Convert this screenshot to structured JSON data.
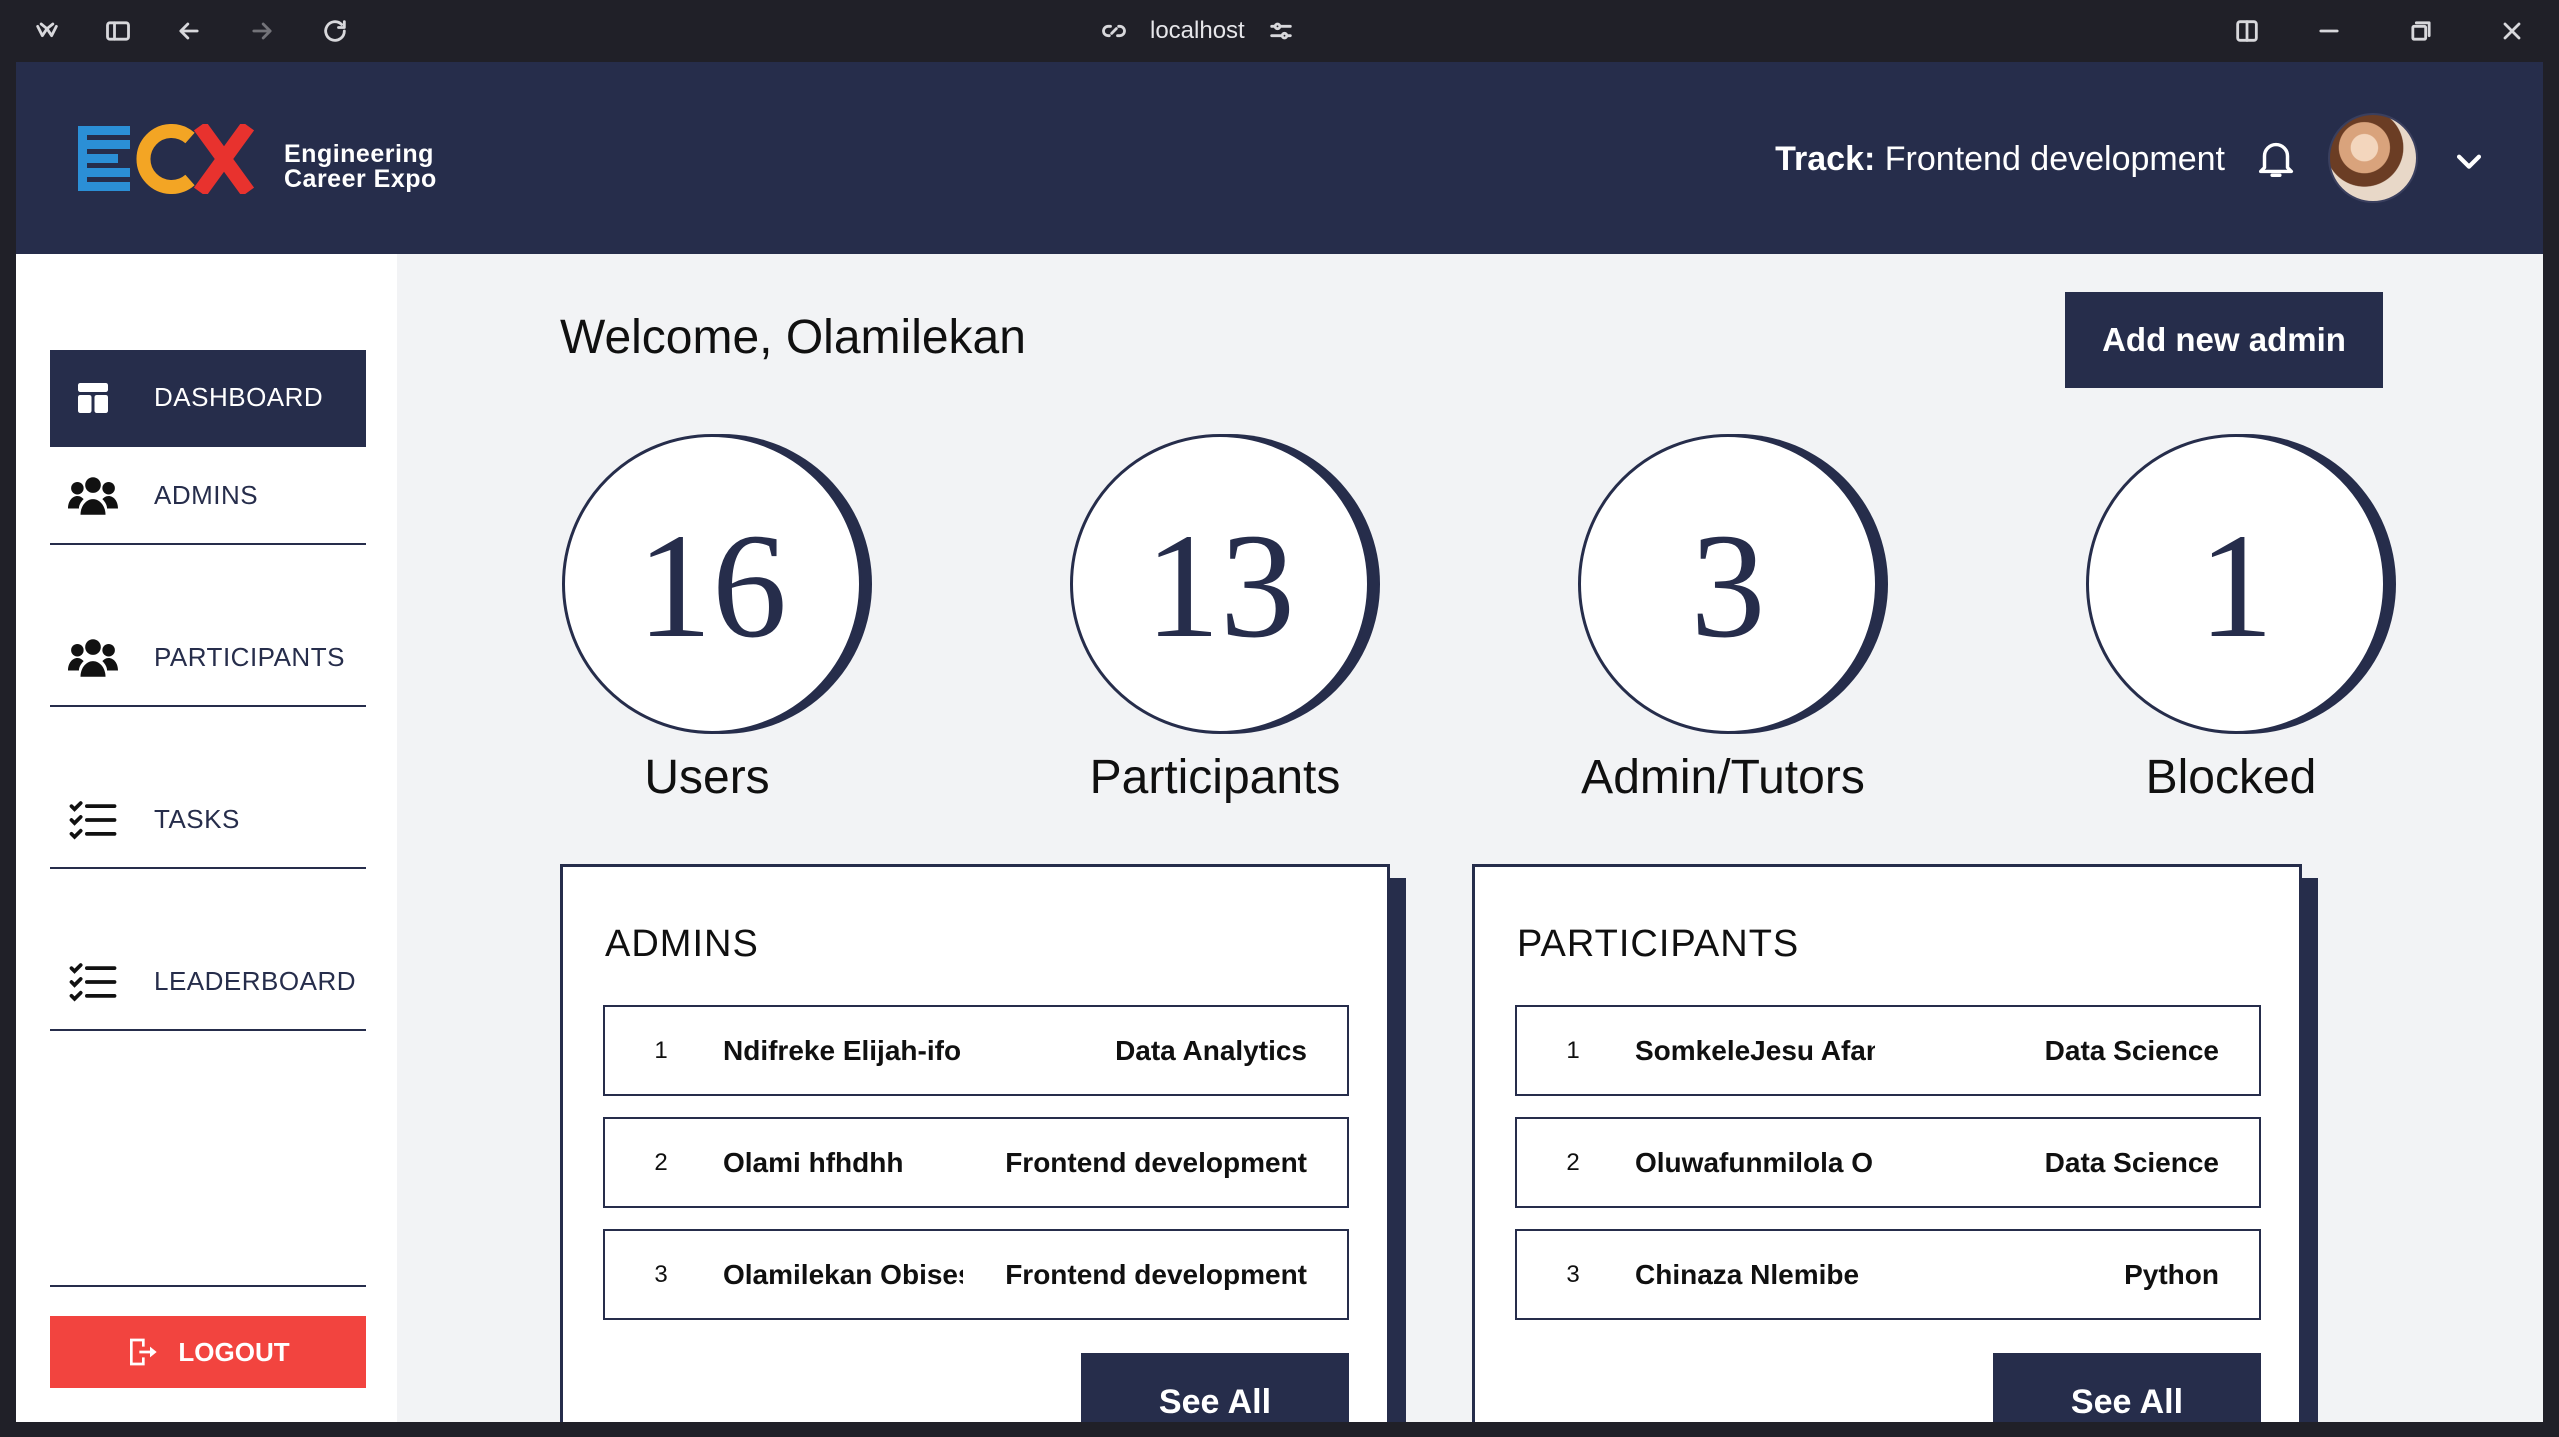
{
  "browser": {
    "address": "localhost"
  },
  "brand": {
    "line1": "Engineering",
    "line2": "Career Expo",
    "colors": {
      "blue": "#2b8fd6",
      "orange": "#f3a524",
      "red": "#e8322e"
    }
  },
  "header": {
    "track_label": "Track:",
    "track_value": "Frontend development"
  },
  "sidebar": {
    "items": [
      {
        "label": "DASHBOARD",
        "icon": "dashboard-icon",
        "active": true
      },
      {
        "label": "ADMINS",
        "icon": "users-group-icon",
        "active": false
      },
      {
        "label": "PARTICIPANTS",
        "icon": "users-group-icon",
        "active": false
      },
      {
        "label": "TASKS",
        "icon": "checklist-icon",
        "active": false
      },
      {
        "label": "LEADERBOARD",
        "icon": "checklist-icon",
        "active": false
      }
    ],
    "logout_label": "LOGOUT"
  },
  "main": {
    "welcome": "Welcome, Olamilekan",
    "add_admin_label": "Add new admin",
    "stats": [
      {
        "value": "16",
        "label": "Users"
      },
      {
        "value": "13",
        "label": "Participants"
      },
      {
        "value": "3",
        "label": "Admin/Tutors"
      },
      {
        "value": "1",
        "label": "Blocked"
      }
    ],
    "admins": {
      "title": "ADMINS",
      "rows": [
        {
          "num": "1",
          "name": "Ndifreke Elijah-ifo",
          "track": "Data Analytics"
        },
        {
          "num": "2",
          "name": "Olami hfhdhh",
          "track": "Frontend development"
        },
        {
          "num": "3",
          "name": "Olamilekan Obises",
          "track": "Frontend development"
        }
      ],
      "see_all": "See All"
    },
    "participants": {
      "title": "PARTICIPANTS",
      "rows": [
        {
          "num": "1",
          "name": "SomkeleJesu Afan",
          "track": "Data Science"
        },
        {
          "num": "2",
          "name": "Oluwafunmilola O",
          "track": "Data Science"
        },
        {
          "num": "3",
          "name": "Chinaza Nlemibe",
          "track": "Python"
        }
      ],
      "see_all": "See All"
    }
  },
  "colors": {
    "navy": "#262d4b",
    "logout": "#f2443f",
    "background": "#f2f3f5"
  }
}
